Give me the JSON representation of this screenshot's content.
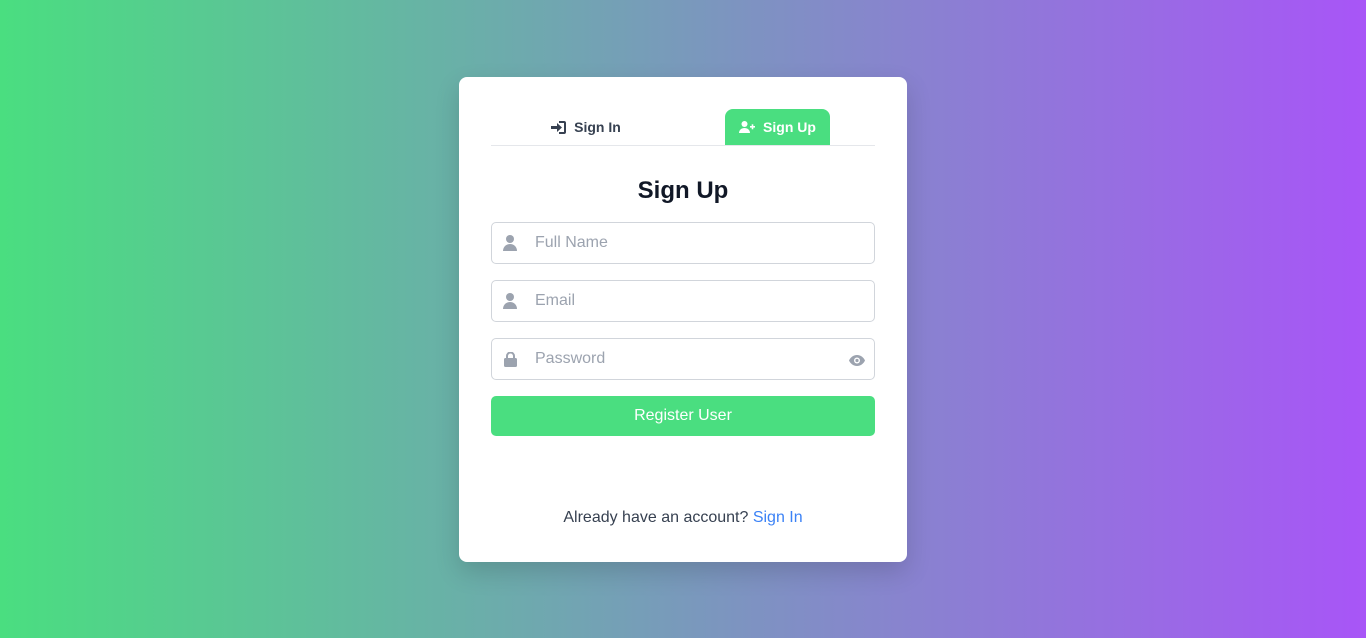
{
  "tabs": {
    "signin_label": "Sign In",
    "signup_label": "Sign Up",
    "active": "signup"
  },
  "form": {
    "title": "Sign Up",
    "fullname_placeholder": "Full Name",
    "email_placeholder": "Email",
    "password_placeholder": "Password",
    "submit_label": "Register User"
  },
  "footer": {
    "prompt": "Already have an account?",
    "link_label": "Sign In"
  },
  "colors": {
    "gradient_start": "#4ade80",
    "gradient_end": "#a855f7",
    "accent": "#4ade80",
    "link": "#3b82f6"
  },
  "icons": {
    "signin_tab": "sign-in-icon",
    "signup_tab": "user-plus-icon",
    "fullname": "user-icon",
    "email": "user-icon",
    "password": "lock-icon",
    "toggle_password": "eye-icon"
  }
}
